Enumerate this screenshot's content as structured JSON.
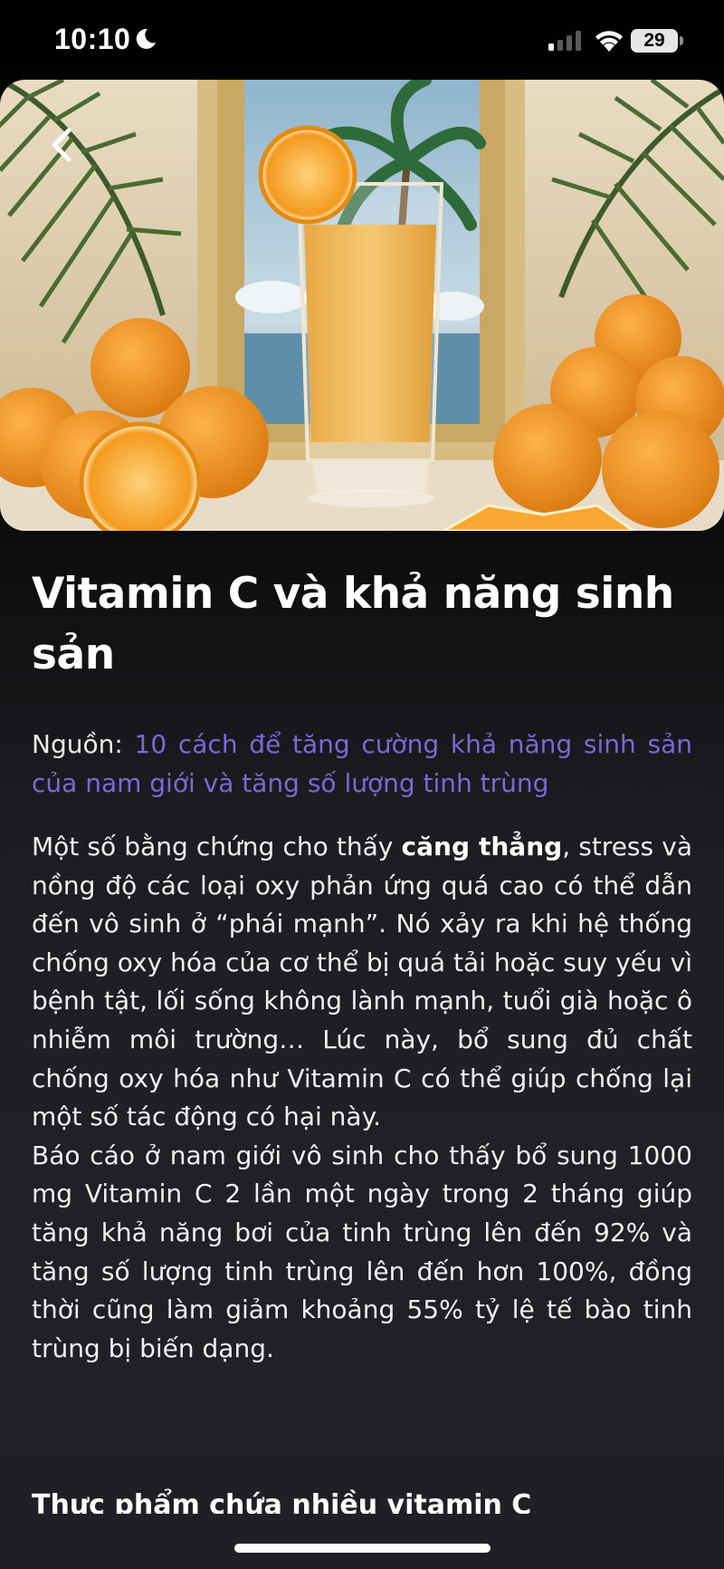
{
  "status_bar": {
    "time": "10:10",
    "battery_level": "29",
    "icons": [
      "moon-icon",
      "signal-icon",
      "wifi-icon",
      "battery-icon"
    ]
  },
  "hero": {
    "image": "orange-juice-glass-with-oranges-and-palm-leaves",
    "back_icon": "chevron-left-icon"
  },
  "article": {
    "title": "Vitamin C và khả năng sinh sản",
    "source_label": "Nguồn: ",
    "source_link": "10 cách để tăng cường khả năng sinh sản của nam giới và tăng số lượng tinh trùng",
    "paragraph1_before": "Một số bằng chứng cho thấy ",
    "paragraph1_bold": "căng thẳng",
    "paragraph1_after": ", stress và nồng độ các loại oxy phản ứng quá cao có thể dẫn đến vô sinh ở “phái mạnh”. Nó xảy ra khi hệ thống chống oxy hóa của cơ thể bị quá tải hoặc suy yếu vì bệnh tật, lối sống không lành mạnh, tuổi già hoặc ô nhiễm môi trường… Lúc này, bổ sung đủ chất chống oxy hóa như Vitamin C có thể giúp chống lại một số tác động có hại này.",
    "paragraph2": "Báo cáo ở nam giới vô sinh cho thấy bổ sung 1000 mg Vitamin C 2 lần một ngày trong 2 tháng giúp tăng khả năng bơi của tinh trùng lên đến 92% và tăng số lượng tinh trùng lên đến hơn 100%, đồng thời cũng làm giảm khoảng 55% tỷ lệ tế bào tinh trùng bị biến dạng.",
    "subheading": "Thực phẩm chứa nhiều vitamin C"
  },
  "colors": {
    "link": "#7b68d6",
    "background_top": "#000000",
    "background_bottom": "#1f2025",
    "text": "#ffffff"
  }
}
